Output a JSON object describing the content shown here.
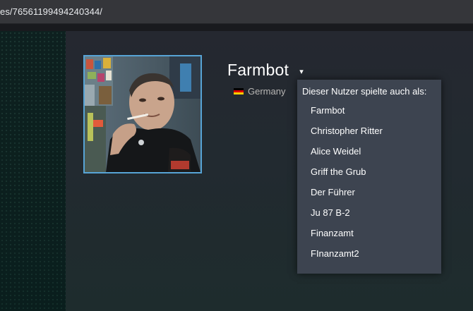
{
  "browser": {
    "url": "es/76561199494240344/"
  },
  "profile": {
    "name": "Farmbot",
    "caret": "▾",
    "country": "Germany",
    "flag_icon": "flag-germany-icon",
    "avatar_icon": "profile-avatar-photo"
  },
  "alias_dropdown": {
    "heading": "Dieser Nutzer spielte auch als:",
    "aliases": [
      "Farmbot",
      "Christopher Ritter",
      "Alice Weidel",
      "Griff the Grub",
      "Der Führer",
      "Ju 87 B-2",
      "Finanzamt",
      "FInanzamt2"
    ]
  },
  "colors": {
    "avatar_border": "#57a4d6",
    "dropdown_bg": "#3d4450",
    "country_text": "#b8b6b4"
  }
}
